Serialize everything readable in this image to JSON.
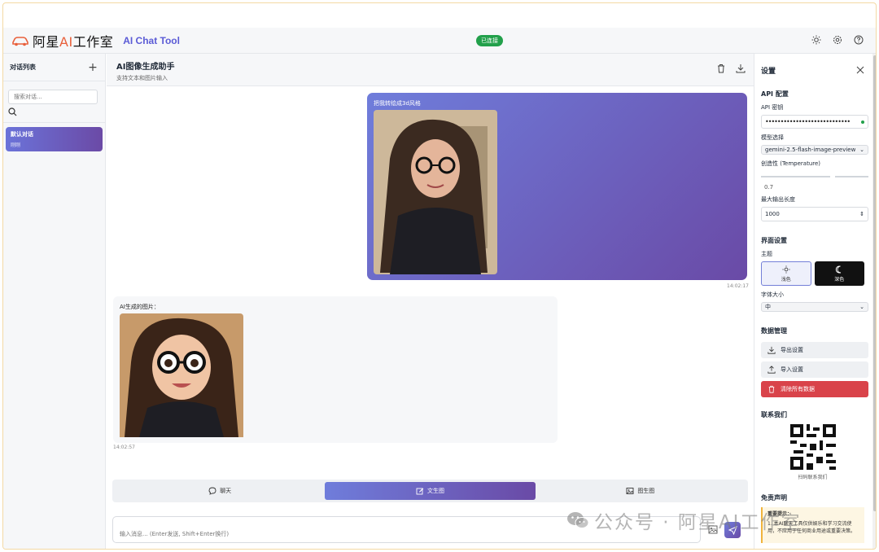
{
  "header": {
    "logo_prefix": "阿星",
    "logo_ai": "AI",
    "logo_suffix": "工作室",
    "app_title": "AI Chat Tool",
    "status": "已连接",
    "icons": [
      "sun-icon",
      "gear-icon",
      "help-icon"
    ]
  },
  "sidebar": {
    "title": "对话列表",
    "add_label": "+",
    "search_placeholder": "搜索对话...",
    "conversations": [
      {
        "name": "默认对话",
        "date": "刚刚"
      }
    ]
  },
  "chat": {
    "title": "AI图像生成助手",
    "subtitle": "支持文本和图片输入",
    "messages": [
      {
        "role": "user",
        "text": "把我转绘成3d风格",
        "time": "14:02:17"
      },
      {
        "role": "assistant",
        "text": "AI生成的图片：",
        "time": "14:02:57"
      }
    ],
    "modes": [
      {
        "label": "聊天",
        "icon": "chat-bubble-icon",
        "active": false
      },
      {
        "label": "文生图",
        "icon": "edit-icon",
        "active": true
      },
      {
        "label": "图生图",
        "icon": "image-icon",
        "active": false
      }
    ],
    "input_placeholder": "输入消息... (Enter发送, Shift+Enter换行)"
  },
  "settings": {
    "title": "设置",
    "api_section": "API 配置",
    "api_key_label": "API 密钥",
    "api_key_value": "••••••••••••••••••••••••••••",
    "model_label": "模型选择",
    "model_value": "gemini-2.5-flash-image-preview",
    "temperature_label": "创造性 (Temperature)",
    "temperature_value": "0.7",
    "temperature_fraction": 0.7,
    "max_tokens_label": "最大输出长度",
    "max_tokens_value": "1000",
    "ui_section": "界面设置",
    "theme_label": "主题",
    "theme_light": "浅色",
    "theme_dark": "深色",
    "font_size_label": "字体大小",
    "font_size_value": "中",
    "data_section": "数据管理",
    "export_label": "导出设置",
    "import_label": "导入设置",
    "clear_label": "清除所有数据",
    "contact_section": "联系我们",
    "qr_caption": "扫码联系我们",
    "disclaimer_section": "免责声明",
    "disclaimer_title": "重要提示：",
    "disclaimer_text": "1. 本AI聊天工具仅供娱乐和学习交流使用，不应用于任何商业用途或重要决策。"
  },
  "watermark": {
    "text": "公众号 · 阿星AI工作室"
  },
  "colors": {
    "accent_start": "#6f7ddb",
    "accent_end": "#6a4aa6",
    "status_green": "#22a04b",
    "danger": "#d9434a"
  }
}
